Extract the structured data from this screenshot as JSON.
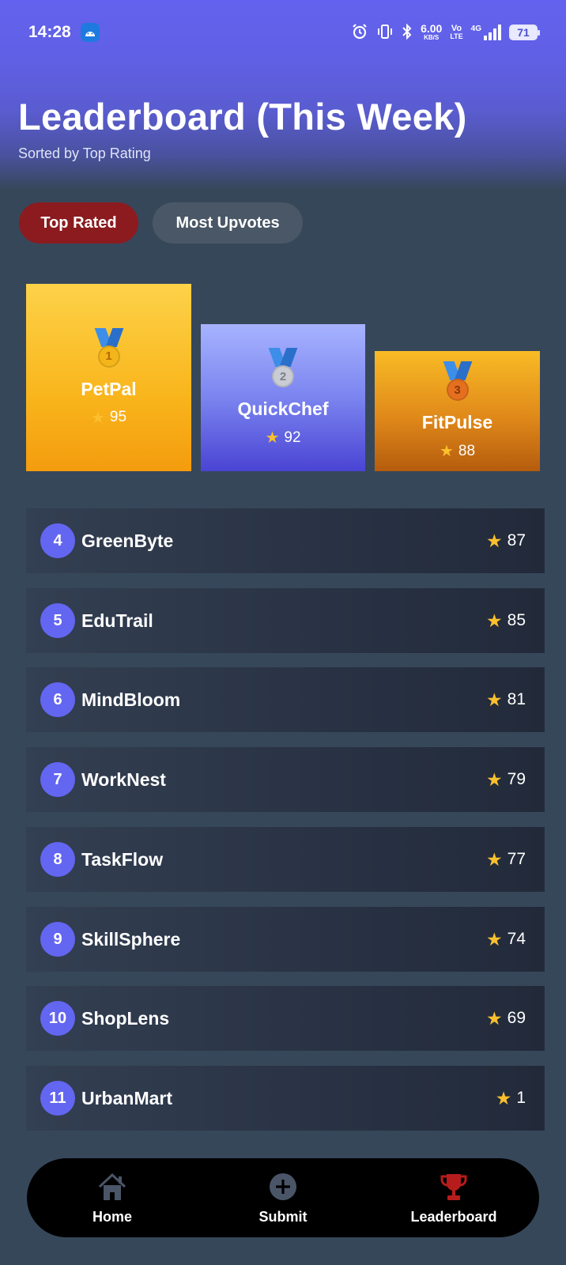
{
  "status_bar": {
    "time": "14:28",
    "speed_value": "6.00",
    "speed_unit": "KB/S",
    "volte_top": "Vo",
    "volte_bottom": "LTE",
    "network": "4G",
    "battery": "71"
  },
  "header": {
    "title": "Leaderboard (This Week)",
    "subtitle": "Sorted by Top Rating"
  },
  "tabs": {
    "top_rated": "Top Rated",
    "most_upvotes": "Most Upvotes"
  },
  "podium": [
    {
      "rank": "1",
      "name": "PetPal",
      "score": "95"
    },
    {
      "rank": "2",
      "name": "QuickChef",
      "score": "92"
    },
    {
      "rank": "3",
      "name": "FitPulse",
      "score": "88"
    }
  ],
  "list": [
    {
      "rank": "4",
      "name": "GreenByte",
      "score": "87"
    },
    {
      "rank": "5",
      "name": "EduTrail",
      "score": "85"
    },
    {
      "rank": "6",
      "name": "MindBloom",
      "score": "81"
    },
    {
      "rank": "7",
      "name": "WorkNest",
      "score": "79"
    },
    {
      "rank": "8",
      "name": "TaskFlow",
      "score": "77"
    },
    {
      "rank": "9",
      "name": "SkillSphere",
      "score": "74"
    },
    {
      "rank": "10",
      "name": "ShopLens",
      "score": "69"
    },
    {
      "rank": "11",
      "name": "UrbanMart",
      "score": "1"
    }
  ],
  "nav": {
    "home": "Home",
    "submit": "Submit",
    "leaderboard": "Leaderboard"
  },
  "colors": {
    "accent": "#6366f1",
    "active_tab": "#8b1b1f",
    "leaderboard_active": "#b71c1c"
  },
  "icons": {
    "star": "star-icon",
    "home": "home-icon",
    "submit": "plus-circle-icon",
    "leaderboard": "trophy-icon"
  }
}
